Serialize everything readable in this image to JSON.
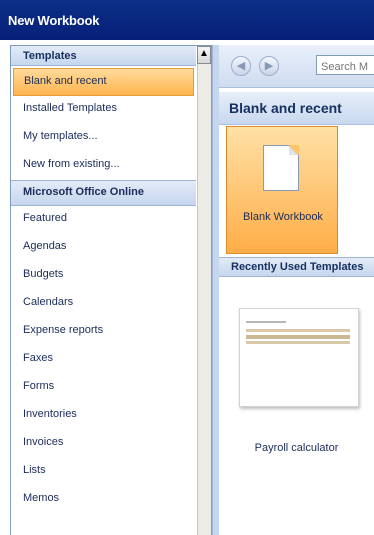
{
  "window": {
    "title": "New Workbook"
  },
  "left_pane": {
    "header": "Templates",
    "scroll_up_glyph": "▲",
    "items": [
      {
        "label": "Blank and recent",
        "type": "item",
        "selected": true
      },
      {
        "label": "Installed Templates",
        "type": "item"
      },
      {
        "label": "My templates...",
        "type": "item"
      },
      {
        "label": "New from existing...",
        "type": "item"
      },
      {
        "label": "Microsoft Office Online",
        "type": "section"
      },
      {
        "label": "Featured",
        "type": "item"
      },
      {
        "label": "Agendas",
        "type": "item"
      },
      {
        "label": "Budgets",
        "type": "item"
      },
      {
        "label": "Calendars",
        "type": "item"
      },
      {
        "label": "Expense reports",
        "type": "item"
      },
      {
        "label": "Faxes",
        "type": "item"
      },
      {
        "label": "Forms",
        "type": "item"
      },
      {
        "label": "Inventories",
        "type": "item"
      },
      {
        "label": "Invoices",
        "type": "item"
      },
      {
        "label": "Lists",
        "type": "item"
      },
      {
        "label": "Memos",
        "type": "item"
      }
    ]
  },
  "right_pane": {
    "nav": {
      "back_icon": "arrow-left-icon",
      "back_glyph": "◀",
      "forward_icon": "arrow-right-icon",
      "forward_glyph": "▶",
      "search_placeholder": "Search M"
    },
    "title": "Blank and recent",
    "blank_tile": {
      "label": "Blank Workbook"
    },
    "recent_header": "Recently Used Templates",
    "recent_items": [
      {
        "label": "Payroll calculator"
      }
    ]
  },
  "colors": {
    "titlebar": "#0c2f86",
    "selection": "#ffb44e",
    "header_blue": "#c6d6ee",
    "text": "#1b2c5a"
  }
}
